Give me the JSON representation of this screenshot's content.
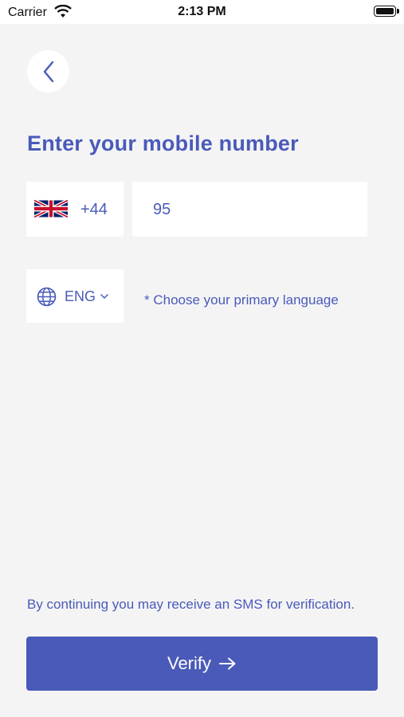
{
  "status_bar": {
    "carrier": "Carrier",
    "time": "2:13 PM"
  },
  "header": {
    "back_icon": "chevron-left-icon"
  },
  "title": "Enter your mobile number",
  "country": {
    "flag_icon": "uk-flag-icon",
    "dial_code": "+44"
  },
  "phone": {
    "value": "95"
  },
  "language": {
    "icon": "globe-icon",
    "selected": "ENG",
    "hint": "* Choose your primary language"
  },
  "footer": {
    "note": "By continuing you may receive an SMS for verification.",
    "verify_label": "Verify"
  },
  "colors": {
    "accent": "#4a5ab9",
    "background": "#f4f4f5"
  }
}
